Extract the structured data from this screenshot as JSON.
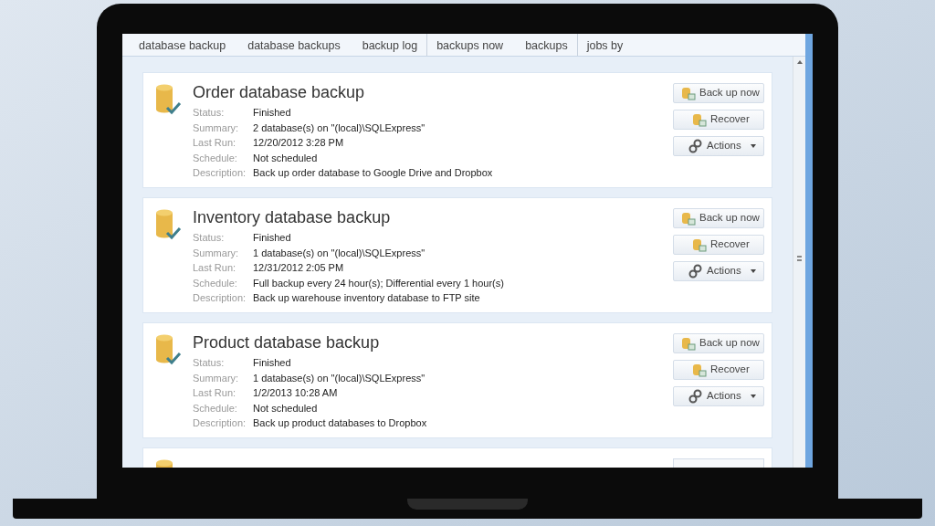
{
  "ribbon": {
    "groups": [
      [
        "database backup",
        "database backups",
        "backup log"
      ],
      [
        "backups now",
        "backups"
      ],
      [
        "jobs by"
      ]
    ]
  },
  "jobs": [
    {
      "title": "Order database backup",
      "fields": [
        {
          "label": "Status:",
          "value": "Finished"
        },
        {
          "label": "Summary:",
          "value": "2 database(s) on \"(local)\\SQLExpress\""
        },
        {
          "label": "Last Run:",
          "value": "12/20/2012 3:28 PM"
        },
        {
          "label": "Schedule:",
          "value": "Not scheduled"
        },
        {
          "label": "Description:",
          "value": "Back up order database to Google Drive and Dropbox"
        }
      ],
      "buttons": [
        {
          "kind": "backup",
          "label": "Back up now"
        },
        {
          "kind": "recover",
          "label": "Recover"
        },
        {
          "kind": "actions",
          "label": "Actions"
        }
      ]
    },
    {
      "title": "Inventory database backup",
      "fields": [
        {
          "label": "Status:",
          "value": "Finished"
        },
        {
          "label": "Summary:",
          "value": "1 database(s) on \"(local)\\SQLExpress\""
        },
        {
          "label": "Last Run:",
          "value": "12/31/2012 2:05 PM"
        },
        {
          "label": "Schedule:",
          "value": "Full backup every 24 hour(s); Differential every 1 hour(s)"
        },
        {
          "label": "Description:",
          "value": "Back up warehouse inventory database to FTP site"
        }
      ],
      "buttons": [
        {
          "kind": "backup",
          "label": "Back up now"
        },
        {
          "kind": "recover",
          "label": "Recover"
        },
        {
          "kind": "actions",
          "label": "Actions"
        }
      ]
    },
    {
      "title": "Product database backup",
      "fields": [
        {
          "label": "Status:",
          "value": "Finished"
        },
        {
          "label": "Summary:",
          "value": "1 database(s) on \"(local)\\SQLExpress\""
        },
        {
          "label": "Last Run:",
          "value": "1/2/2013 10:28 AM"
        },
        {
          "label": "Schedule:",
          "value": "Not scheduled"
        },
        {
          "label": "Description:",
          "value": "Back up product databases to Dropbox"
        }
      ],
      "buttons": [
        {
          "kind": "backup",
          "label": "Back up now"
        },
        {
          "kind": "recover",
          "label": "Recover"
        },
        {
          "kind": "actions",
          "label": "Actions"
        }
      ]
    }
  ]
}
